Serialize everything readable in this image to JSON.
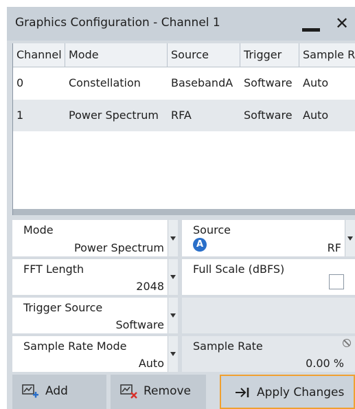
{
  "window": {
    "title": "Graphics Configuration - Channel 1"
  },
  "table": {
    "columns": [
      "Channel",
      "Mode",
      "Source",
      "Trigger",
      "Sample R"
    ],
    "rows": [
      {
        "channel": "0",
        "mode": "Constellation",
        "source": "BasebandA",
        "trigger": "Software",
        "sample_rate": "Auto"
      },
      {
        "channel": "1",
        "mode": "Power Spectrum",
        "source": "RFA",
        "trigger": "Software",
        "sample_rate": "Auto"
      }
    ],
    "selected_row": 1
  },
  "form": {
    "mode": {
      "label": "Mode",
      "value": "Power Spectrum"
    },
    "source": {
      "label": "Source",
      "badge": "A",
      "value": "RF"
    },
    "fft_length": {
      "label": "FFT Length",
      "value": "2048"
    },
    "full_scale": {
      "label": "Full Scale (dBFS)",
      "checked": false
    },
    "trigger_source": {
      "label": "Trigger Source",
      "value": "Software"
    },
    "sample_rate_mode": {
      "label": "Sample Rate Mode",
      "value": "Auto"
    },
    "sample_rate": {
      "label": "Sample Rate",
      "value": "0.00 %"
    }
  },
  "buttons": {
    "add": "Add",
    "remove": "Remove",
    "apply": "Apply Changes"
  },
  "colors": {
    "apply_border": "#f0a030",
    "badge": "#2a6fc9",
    "remove_icon": "#d9302a",
    "add_icon": "#2a6fc9"
  }
}
